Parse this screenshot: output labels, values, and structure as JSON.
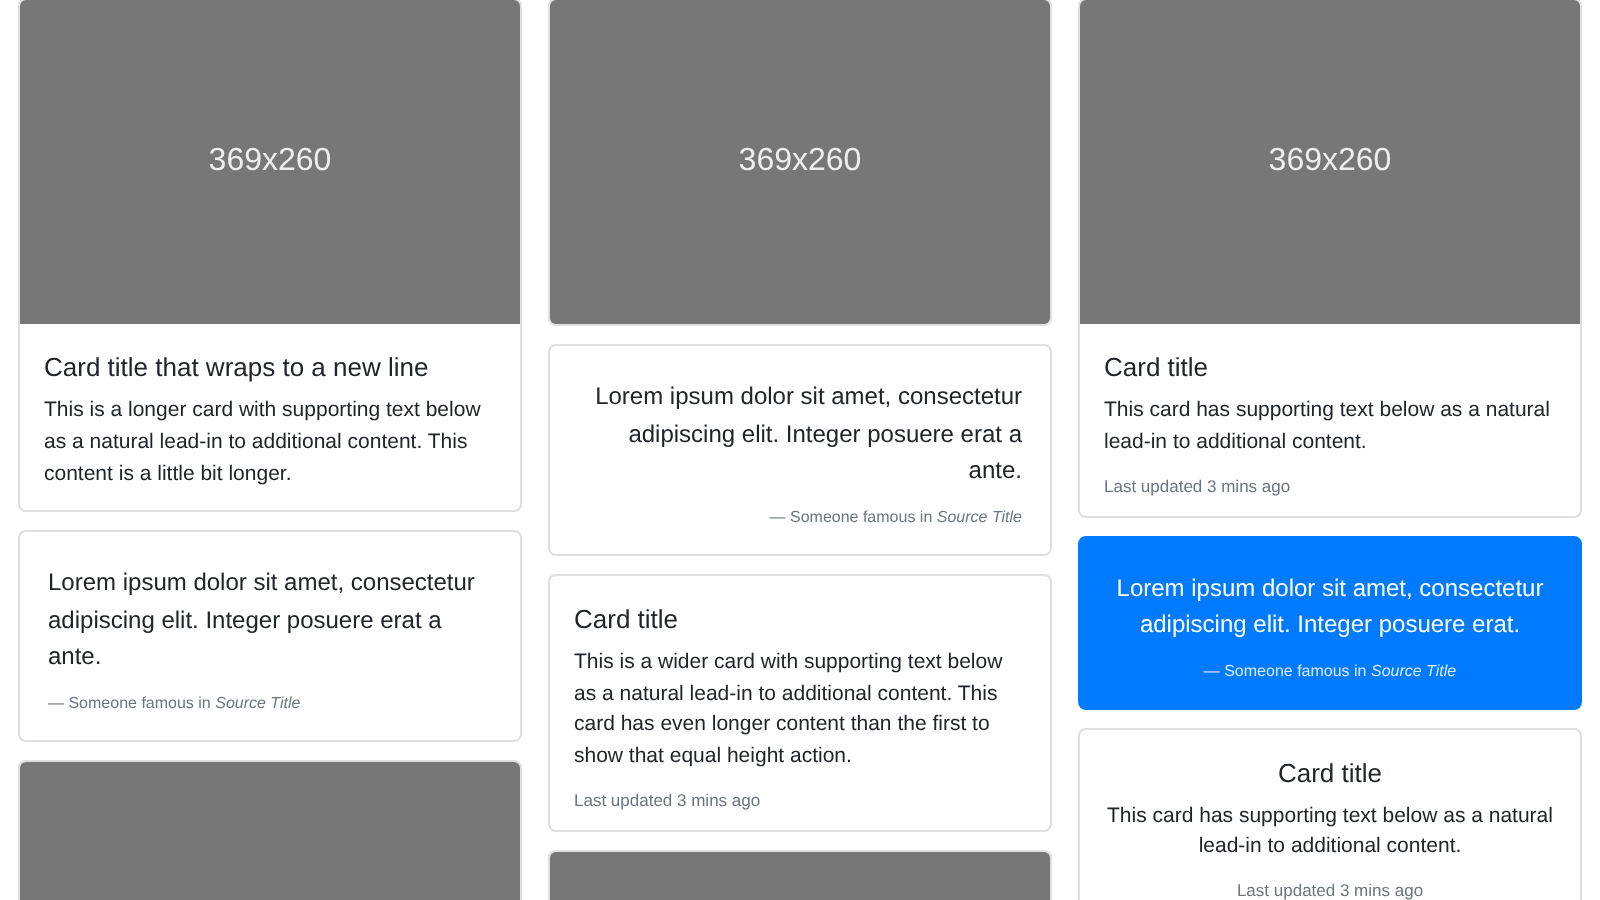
{
  "columns": [
    {
      "cards": [
        {
          "kind": "image",
          "image": {
            "label": "369x260"
          },
          "title": "Card title that wraps to a new line",
          "text": "This is a longer card with supporting text below as a natural lead-in to additional content. This content is a little bit longer."
        },
        {
          "kind": "quote",
          "quote": "Lorem ipsum dolor sit amet, consectetur adipiscing elit. Integer posuere erat a ante.",
          "attribution": "— Someone famous in *Source Title*"
        },
        {
          "kind": "placeholder"
        }
      ]
    },
    {
      "cards": [
        {
          "kind": "image",
          "image": {
            "label": "369x260"
          }
        },
        {
          "kind": "rightquote",
          "quote": "Lorem ipsum dolor sit amet, consectetur adipiscing elit. Integer posuere erat a ante.",
          "attribution": "— Someone famous in *Source Title*"
        },
        {
          "kind": "text",
          "title": "Card title",
          "text": "This is a wider card with supporting text below as a natural lead-in to additional content. This card has even longer content than the first to show that equal height action.",
          "updated": "Last updated 3 mins ago"
        },
        {
          "kind": "placeholder"
        }
      ]
    },
    {
      "cards": [
        {
          "kind": "image",
          "image": {
            "label": "369x260"
          },
          "title": "Card title",
          "text": "This card has supporting text below as a natural lead-in to additional content.",
          "updated": "Last updated 3 mins ago"
        },
        {
          "kind": "bluequote",
          "quote": "Lorem ipsum dolor sit amet, consectetur adipiscing elit. Integer posuere erat.",
          "attribution": "— Someone famous in *Source Title*"
        },
        {
          "kind": "centertext",
          "title": "Card title",
          "text": "This card has supporting text below as a natural lead-in to additional content.",
          "updated": "Last updated 3 mins ago"
        }
      ]
    }
  ]
}
